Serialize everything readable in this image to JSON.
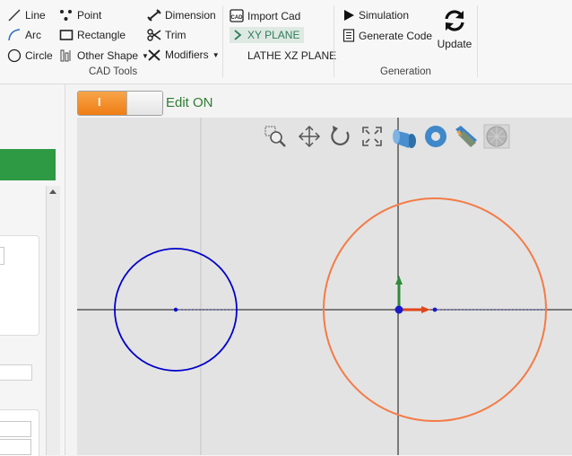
{
  "ribbon": {
    "cad_tools": {
      "label": "CAD Tools",
      "line": "Line",
      "arc": "Arc",
      "circle": "Circle",
      "point": "Point",
      "rectangle": "Rectangle",
      "other_shape": "Other Shape",
      "dimension": "Dimension",
      "trim": "Trim",
      "modifiers": "Modifiers"
    },
    "planes": {
      "import_cad": "Import Cad",
      "xy_plane": "XY PLANE",
      "lathe_xz_plane": "LATHE XZ PLANE"
    },
    "generation": {
      "label": "Generation",
      "simulation": "Simulation",
      "generate_code": "Generate Code",
      "update": "Update"
    }
  },
  "edit_toggle": {
    "on_text": "I",
    "label": "Edit ON",
    "state": "on"
  },
  "colors": {
    "accent_orange": "#ef7d14",
    "circle_blue": "#0000cc",
    "circle_orange": "#f47b47",
    "green_bar": "#2e9a44",
    "edit_green": "#2e7d32"
  }
}
